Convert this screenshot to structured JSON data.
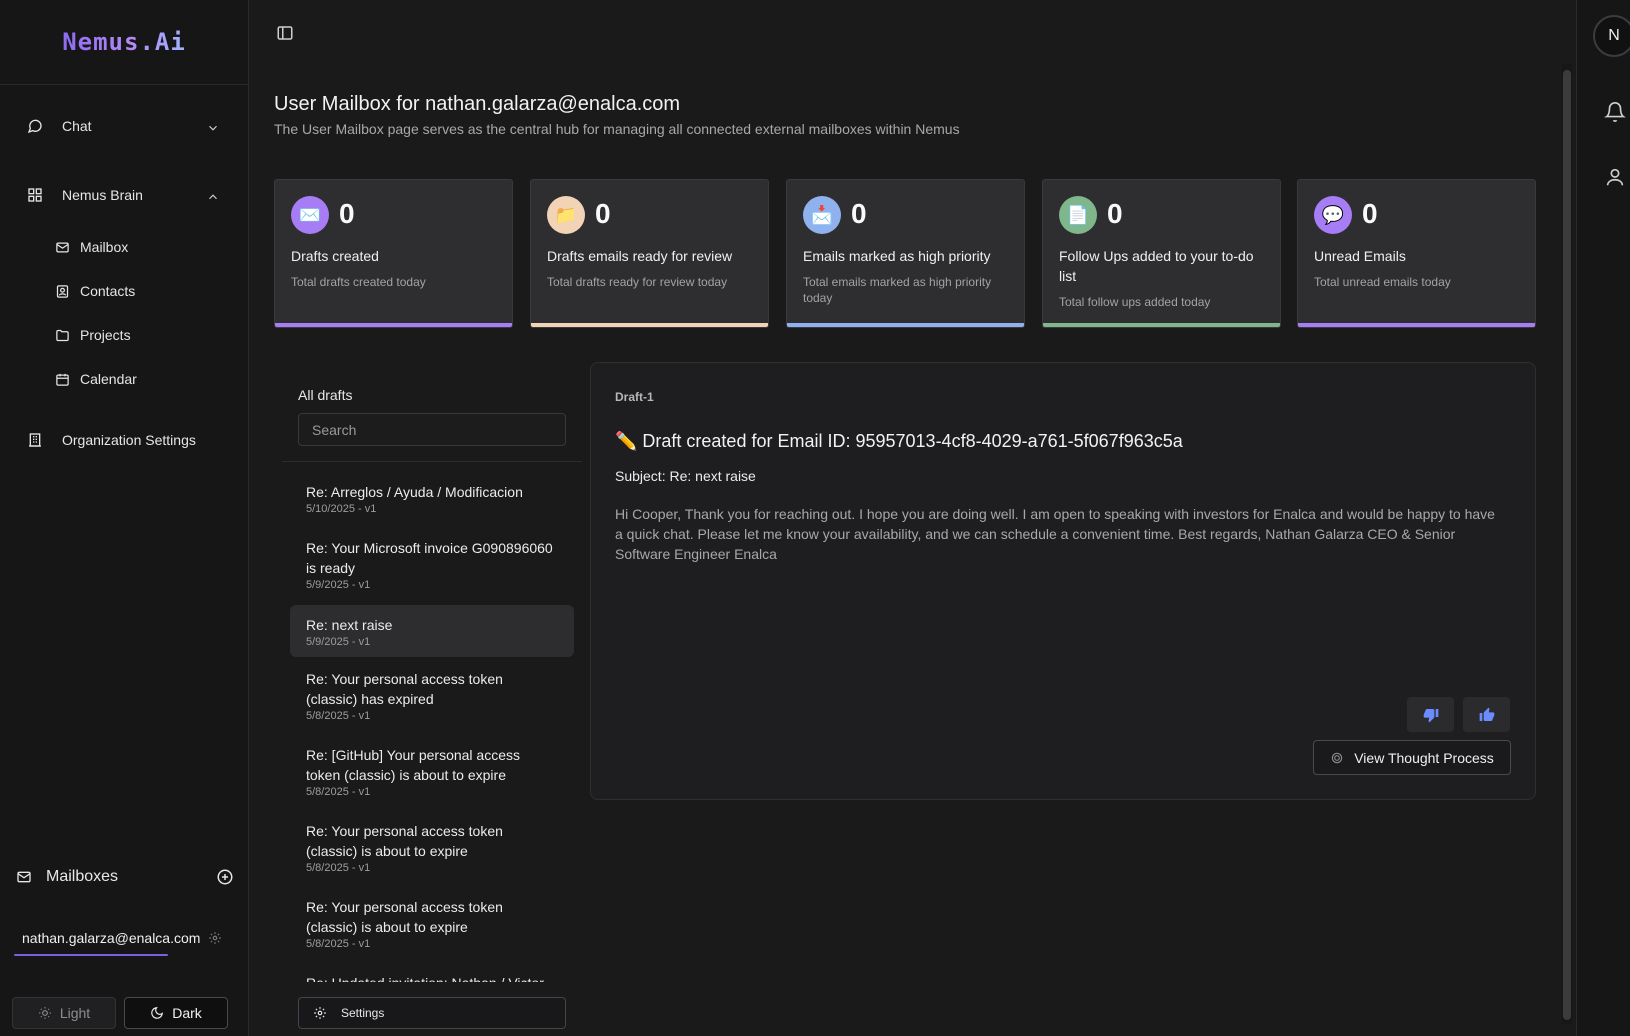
{
  "brand": {
    "logo": "Nemus.Ai"
  },
  "sidebar": {
    "chat": "Chat",
    "brain": "Nemus Brain",
    "sub_items": [
      "Mailbox",
      "Contacts",
      "Projects",
      "Calendar"
    ],
    "org_settings": "Organization Settings",
    "mailboxes_label": "Mailboxes",
    "mailbox_email": "nathan.galarza@enalca.com",
    "theme_light": "Light",
    "theme_dark": "Dark"
  },
  "page": {
    "title": "User Mailbox for nathan.galarza@enalca.com",
    "subtitle": "The User Mailbox page serves as the central hub for managing all connected external mailboxes within Nemus"
  },
  "stats": [
    {
      "value": "0",
      "title": "Drafts created",
      "desc": "Total drafts created today",
      "color": "#a77df5",
      "icon_bg": "#a77df5"
    },
    {
      "value": "0",
      "title": "Drafts emails ready for review",
      "desc": "Total drafts ready for review today",
      "color": "#f3d3b6",
      "icon_bg": "#f3d3b6"
    },
    {
      "value": "0",
      "title": "Emails marked as high priority",
      "desc": "Total emails marked as high priority today",
      "color": "#8fb2ef",
      "icon_bg": "#8fb2ef"
    },
    {
      "value": "0",
      "title": "Follow Ups added to your to-do list",
      "desc": "Total follow ups added today",
      "color": "#7fb68c",
      "icon_bg": "#7fb68c"
    },
    {
      "value": "0",
      "title": "Unread Emails",
      "desc": "Total unread emails today",
      "color": "#a77df5",
      "icon_bg": "#a77df5"
    }
  ],
  "drafts": {
    "header": "All drafts",
    "search_placeholder": "Search",
    "items": [
      {
        "subject": "Re: Arreglos / Ayuda / Modificacion",
        "date": "5/10/2025 - v1"
      },
      {
        "subject": "Re: Your Microsoft invoice G090896060 is ready",
        "date": "5/9/2025 - v1"
      },
      {
        "subject": "Re: next raise",
        "date": "5/9/2025 - v1"
      },
      {
        "subject": "Re: Your personal access token (classic) has expired",
        "date": "5/8/2025 - v1"
      },
      {
        "subject": "Re: [GitHub] Your personal access token (classic) is about to expire",
        "date": "5/8/2025 - v1"
      },
      {
        "subject": "Re: Your personal access token (classic) is about to expire",
        "date": "5/8/2025 - v1"
      },
      {
        "subject": "Re: Your personal access token (classic) is about to expire",
        "date": "5/8/2025 - v1"
      },
      {
        "subject": "Re: Updated invitation: Nathan / Victor @",
        "date": ""
      }
    ],
    "settings_label": "Settings"
  },
  "draft_detail": {
    "label": "Draft-1",
    "heading": "✏️ Draft created for Email ID: 95957013-4cf8-4029-a761-5f067f963c5a",
    "subject": "Subject: Re: next raise",
    "body": "Hi Cooper, Thank you for reaching out. I hope you are doing well. I am open to speaking with investors for Enalca and would be happy to have a quick chat. Please let me know your availability, and we can schedule a convenient time. Best regards, Nathan Galarza CEO & Senior Software Engineer Enalca",
    "thought_button": "View Thought Process"
  },
  "user": {
    "initial": "N"
  },
  "colors": {
    "accent": "#7b5fe0",
    "thumb_icon": "#6b8cff"
  }
}
